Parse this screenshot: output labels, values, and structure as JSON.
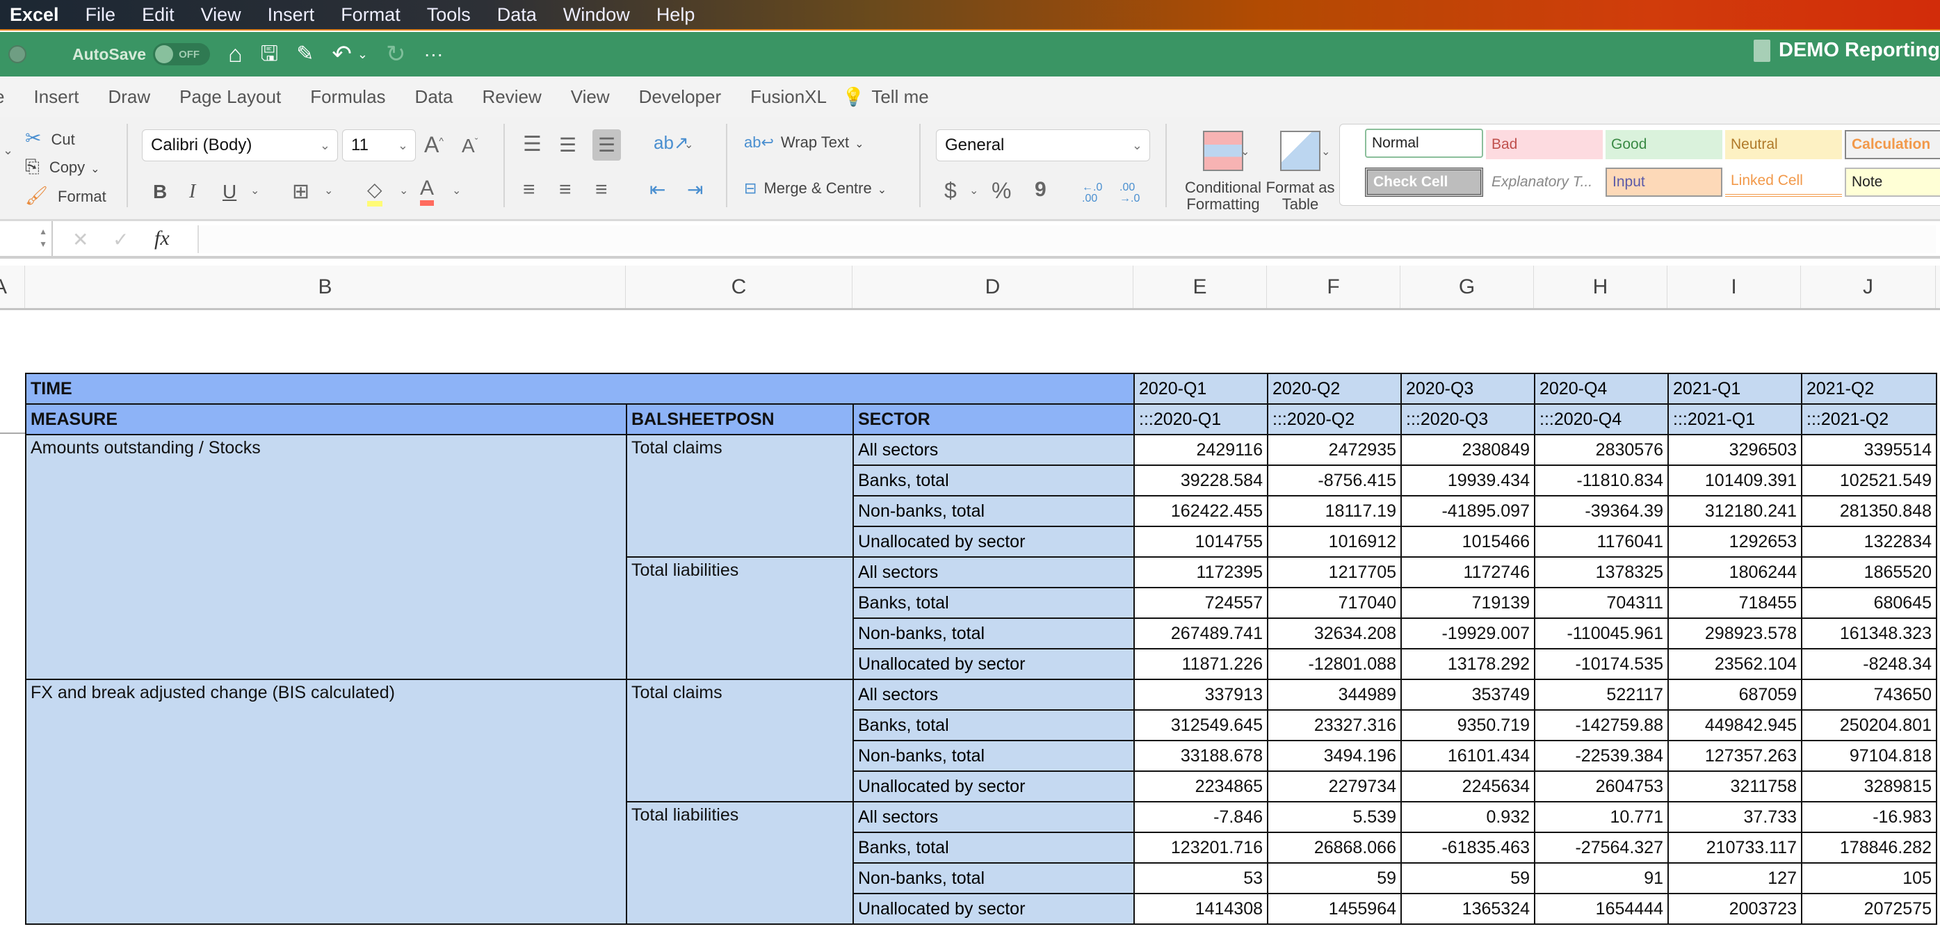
{
  "menubar": {
    "app": "Excel",
    "items": [
      "File",
      "Edit",
      "View",
      "Insert",
      "Format",
      "Tools",
      "Data",
      "Window",
      "Help"
    ]
  },
  "toolbar": {
    "autosave_label": "AutoSave",
    "autosave_state": "OFF",
    "doc_title": "DEMO Reporting"
  },
  "tabs": [
    "e",
    "Insert",
    "Draw",
    "Page Layout",
    "Formulas",
    "Data",
    "Review",
    "View",
    "Developer",
    "FusionXL",
    "Tell me"
  ],
  "ribbon": {
    "clipboard": {
      "cut": "Cut",
      "copy": "Copy",
      "format": "Format"
    },
    "font": {
      "family": "Calibri (Body)",
      "size": "11",
      "bold": "B",
      "italic": "I",
      "underline": "U"
    },
    "alignment": {
      "wrap": "Wrap Text",
      "merge": "Merge & Centre"
    },
    "number": {
      "format": "General",
      "currency": "$",
      "percent": "%",
      "comma": "9",
      "inc_dec": "←.0 .00",
      "dec_dec": ".00 →.0"
    },
    "conditional_formatting": "Conditional Formatting",
    "format_as_table": "Format as Table",
    "cell_styles": [
      "Normal",
      "Bad",
      "Good",
      "Neutral",
      "Calculation",
      "Check Cell",
      "Explanatory T...",
      "Input",
      "Linked Cell",
      "Note"
    ]
  },
  "formula_bar": {
    "name_box": "",
    "fx": "fx",
    "formula": ""
  },
  "columns": [
    "A",
    "B",
    "C",
    "D",
    "E",
    "F",
    "G",
    "H",
    "I",
    "J"
  ],
  "table": {
    "time_label": "TIME",
    "headers": {
      "measure": "MEASURE",
      "balsheet": "BALSHEETPOSN",
      "sector": "SECTOR"
    },
    "periods": [
      "2020-Q1",
      "2020-Q2",
      "2020-Q3",
      "2020-Q4",
      "2021-Q1",
      "2021-Q2"
    ],
    "period_codes": [
      ":::2020-Q1",
      ":::2020-Q2",
      ":::2020-Q3",
      ":::2020-Q4",
      ":::2021-Q1",
      ":::2021-Q2"
    ],
    "measures": [
      {
        "name": "Amounts outstanding / Stocks",
        "groups": [
          {
            "balsheet": "Total claims",
            "rows": [
              {
                "sector": "All sectors",
                "values": [
                  "2429116",
                  "2472935",
                  "2380849",
                  "2830576",
                  "3296503",
                  "3395514"
                ]
              },
              {
                "sector": "Banks, total",
                "values": [
                  "39228.584",
                  "-8756.415",
                  "19939.434",
                  "-11810.834",
                  "101409.391",
                  "102521.549"
                ]
              },
              {
                "sector": "Non-banks, total",
                "values": [
                  "162422.455",
                  "18117.19",
                  "-41895.097",
                  "-39364.39",
                  "312180.241",
                  "281350.848"
                ]
              },
              {
                "sector": "Unallocated by sector",
                "values": [
                  "1014755",
                  "1016912",
                  "1015466",
                  "1176041",
                  "1292653",
                  "1322834"
                ]
              }
            ]
          },
          {
            "balsheet": "Total liabilities",
            "rows": [
              {
                "sector": "All sectors",
                "values": [
                  "1172395",
                  "1217705",
                  "1172746",
                  "1378325",
                  "1806244",
                  "1865520"
                ]
              },
              {
                "sector": "Banks, total",
                "values": [
                  "724557",
                  "717040",
                  "719139",
                  "704311",
                  "718455",
                  "680645"
                ]
              },
              {
                "sector": "Non-banks, total",
                "values": [
                  "267489.741",
                  "32634.208",
                  "-19929.007",
                  "-110045.961",
                  "298923.578",
                  "161348.323"
                ]
              },
              {
                "sector": "Unallocated by sector",
                "values": [
                  "11871.226",
                  "-12801.088",
                  "13178.292",
                  "-10174.535",
                  "23562.104",
                  "-8248.34"
                ]
              }
            ]
          }
        ]
      },
      {
        "name": "FX and break adjusted change (BIS calculated)",
        "groups": [
          {
            "balsheet": "Total claims",
            "rows": [
              {
                "sector": "All sectors",
                "values": [
                  "337913",
                  "344989",
                  "353749",
                  "522117",
                  "687059",
                  "743650"
                ]
              },
              {
                "sector": "Banks, total",
                "values": [
                  "312549.645",
                  "23327.316",
                  "9350.719",
                  "-142759.88",
                  "449842.945",
                  "250204.801"
                ]
              },
              {
                "sector": "Non-banks, total",
                "values": [
                  "33188.678",
                  "3494.196",
                  "16101.434",
                  "-22539.384",
                  "127357.263",
                  "97104.818"
                ]
              },
              {
                "sector": "Unallocated by sector",
                "values": [
                  "2234865",
                  "2279734",
                  "2245634",
                  "2604753",
                  "3211758",
                  "3289815"
                ]
              }
            ]
          },
          {
            "balsheet": "Total liabilities",
            "rows": [
              {
                "sector": "All sectors",
                "values": [
                  "-7.846",
                  "5.539",
                  "0.932",
                  "10.771",
                  "37.733",
                  "-16.983"
                ]
              },
              {
                "sector": "Banks, total",
                "values": [
                  "123201.716",
                  "26868.066",
                  "-61835.463",
                  "-27564.327",
                  "210733.117",
                  "178846.282"
                ]
              },
              {
                "sector": "Non-banks, total",
                "values": [
                  "53",
                  "59",
                  "59",
                  "91",
                  "127",
                  "105"
                ]
              },
              {
                "sector": "Unallocated by sector",
                "values": [
                  "1414308",
                  "1455964",
                  "1365324",
                  "1654444",
                  "2003723",
                  "2072575"
                ]
              }
            ]
          }
        ]
      }
    ]
  }
}
